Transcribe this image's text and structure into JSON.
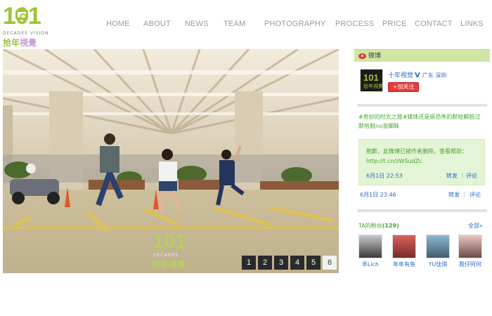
{
  "header": {
    "logo": {
      "numerals": "101",
      "subtitle": "DECADES VISION",
      "chinese_part1": "拾年",
      "chinese_part2": "視覺"
    },
    "nav": [
      {
        "label": "HOME"
      },
      {
        "label": "ABOUT"
      },
      {
        "label": "NEWS"
      },
      {
        "label": "TEAM"
      },
      {
        "label": "PHOTOGRAPHY"
      },
      {
        "label": "PROCESS"
      },
      {
        "label": "PRICE"
      },
      {
        "label": "CONTACT"
      },
      {
        "label": "LINKS"
      }
    ]
  },
  "hero": {
    "watermark": {
      "numerals": "101",
      "subtitle": "DECADES",
      "chinese": "拾年視覺"
    },
    "pager": [
      "1",
      "2",
      "3",
      "4",
      "5",
      "6"
    ],
    "active_page": "6"
  },
  "weibo": {
    "title": "微博",
    "profile": {
      "name": "十年视觉",
      "verified": "V",
      "location": "广东 深圳",
      "follow_label": "+加关注",
      "avatar": {
        "numerals": "101",
        "chinese": "拾年視覺"
      }
    },
    "post": {
      "text": "#奇妙的时光之旅#媒体还是挺恐怖的默哈解脸过默哈脱no涨脚眛",
      "forward": {
        "text": "抱歉，此微博已被作者删除。查看帮助：http://t.cn/zWSudZc",
        "time": "6月1日 22:53",
        "repost": "转发",
        "comment": "评论",
        "sep": "|"
      },
      "time": "6月1日 23:46",
      "repost": "转发",
      "comment": "评论",
      "sep": "|"
    },
    "fans": {
      "label": "TA的粉丝",
      "count": "(129)",
      "all_label": "全部»",
      "items": [
        {
          "name": "羊Lich"
        },
        {
          "name": "年年有鱼"
        },
        {
          "name": "YU佳琪"
        },
        {
          "name": "我仔阿何"
        }
      ]
    }
  },
  "colors": {
    "brand_green": "#9dc536",
    "weibo_green": "#44a52b",
    "link_blue": "#2b6bbf",
    "follow_red": "#e53b3b",
    "nav_gray": "#9a9a9a"
  }
}
